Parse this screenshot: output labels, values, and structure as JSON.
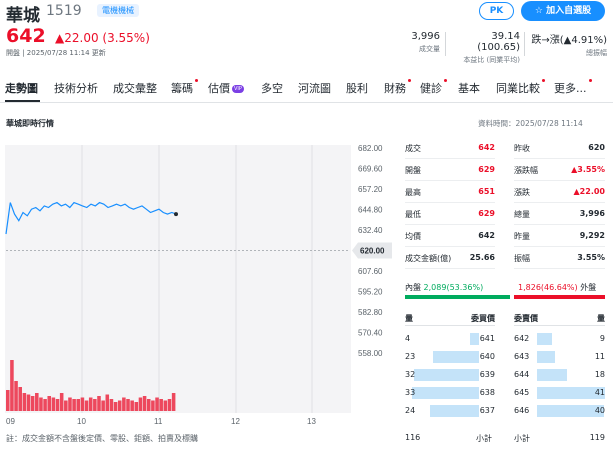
{
  "header": {
    "name": "華城",
    "code": "1519",
    "sector": "電機機械",
    "pk_label": "PK",
    "watch_label": "加入自選股",
    "price": "642",
    "change": "22.00 (3.55%)",
    "market_status": "開盤 | 2025/07/28 11:14 更新",
    "volume_value": "3,996",
    "volume_label": "成交量",
    "pe_value": "39.14 (100.65)",
    "pe_label": "本益比 (同業平均)",
    "limit_value": "跌→漲(▲4.91%)",
    "limit_label": "總振幅",
    "up_color": "#eb0f29",
    "down_color": "#00ab5e",
    "accent_color": "#188fff"
  },
  "tabs": [
    {
      "label": "走勢圖",
      "active": true,
      "dot": false
    },
    {
      "label": "技術分析",
      "active": false,
      "dot": false
    },
    {
      "label": "成交彙整",
      "active": false,
      "dot": false
    },
    {
      "label": "籌碼",
      "active": false,
      "dot": true
    },
    {
      "label": "估價",
      "active": false,
      "dot": false,
      "vip": "VIP"
    },
    {
      "label": "多空",
      "active": false,
      "dot": false
    },
    {
      "label": "河流圖",
      "active": false,
      "dot": false
    },
    {
      "label": "股利",
      "active": false,
      "dot": false
    },
    {
      "label": "財務",
      "active": false,
      "dot": true
    },
    {
      "label": "健診",
      "active": false,
      "dot": true
    },
    {
      "label": "基本",
      "active": false,
      "dot": false
    },
    {
      "label": "同業比較",
      "active": false,
      "dot": true
    },
    {
      "label": "更多...",
      "active": false,
      "dot": true
    }
  ],
  "section": {
    "title": "華城即時行情",
    "data_time": "資料時間：2025/07/28 11:14"
  },
  "chart_data": {
    "type": "line",
    "y_ticks": [
      "682.00",
      "669.60",
      "657.20",
      "644.80",
      "632.40",
      "620.00",
      "607.60",
      "595.20",
      "582.80",
      "570.40",
      "558.00"
    ],
    "ylim": [
      558,
      682
    ],
    "reference_price": "620.00",
    "x_ticks": [
      "09",
      "10",
      "11",
      "12",
      "13"
    ],
    "series": [
      {
        "values": [
          630,
          649,
          642,
          638,
          643,
          641,
          645,
          646,
          644,
          647,
          646,
          648,
          649,
          647,
          648,
          646,
          649,
          648,
          647,
          646,
          648,
          647,
          649,
          648,
          646,
          647,
          648,
          647,
          648,
          646,
          645,
          646,
          647,
          645,
          643,
          644,
          645,
          643,
          642,
          643,
          642
        ]
      }
    ],
    "volume": [
      14,
      34,
      20,
      16,
      12,
      11,
      10,
      12,
      9,
      8,
      10,
      9,
      8,
      12,
      7,
      9,
      8,
      8,
      9,
      7,
      9,
      8,
      10,
      7,
      11,
      8,
      6,
      7,
      9,
      8,
      7,
      6,
      9,
      10,
      8,
      7,
      9,
      8,
      7,
      8,
      12
    ]
  },
  "stats_left": [
    {
      "k": "成交",
      "v": "642",
      "color": "#eb0f29"
    },
    {
      "k": "開盤",
      "v": "629",
      "color": "#eb0f29"
    },
    {
      "k": "最高",
      "v": "651",
      "color": "#eb0f29"
    },
    {
      "k": "最低",
      "v": "629",
      "color": "#eb0f29"
    },
    {
      "k": "均價",
      "v": "642",
      "color": "#232a31"
    },
    {
      "k": "成交金額(億)",
      "v": "25.66",
      "color": "#232a31"
    }
  ],
  "stats_right": [
    {
      "k": "昨收",
      "v": "620",
      "color": "#232a31"
    },
    {
      "k": "漲跌幅",
      "v": "▲3.55%",
      "color": "#eb0f29"
    },
    {
      "k": "漲跌",
      "v": "▲22.00",
      "color": "#eb0f29"
    },
    {
      "k": "總量",
      "v": "3,996",
      "color": "#232a31"
    },
    {
      "k": "昨量",
      "v": "9,292",
      "color": "#232a31"
    },
    {
      "k": "振幅",
      "v": "3.55%",
      "color": "#232a31"
    }
  ],
  "inout": {
    "in_label": "內盤",
    "in_value": "2,089(53.36%)",
    "out_value": "1,826(46.64%)",
    "out_label": "外盤",
    "in_pct": 53.36
  },
  "orderbook": {
    "bid_qty_label": "量",
    "bid_price_label": "委買價",
    "ask_price_label": "委賣價",
    "ask_qty_label": "量",
    "bids": [
      {
        "qty": "4",
        "price": "641",
        "ratio": 0.12
      },
      {
        "qty": "23",
        "price": "640",
        "ratio": 0.6
      },
      {
        "qty": "32",
        "price": "639",
        "ratio": 0.85
      },
      {
        "qty": "33",
        "price": "638",
        "ratio": 0.88
      },
      {
        "qty": "24",
        "price": "637",
        "ratio": 0.64
      }
    ],
    "asks": [
      {
        "price": "642",
        "qty": "9",
        "ratio": 0.22
      },
      {
        "price": "643",
        "qty": "11",
        "ratio": 0.27
      },
      {
        "price": "644",
        "qty": "18",
        "ratio": 0.44
      },
      {
        "price": "645",
        "qty": "41",
        "ratio": 1.0
      },
      {
        "price": "646",
        "qty": "40",
        "ratio": 0.98
      }
    ],
    "bid_total": "116",
    "bid_total_label": "小計",
    "ask_total_label": "小計",
    "ask_total": "119"
  },
  "note": "註：成交金額不含盤後定價、零股、鉅額、拍賣及標購"
}
